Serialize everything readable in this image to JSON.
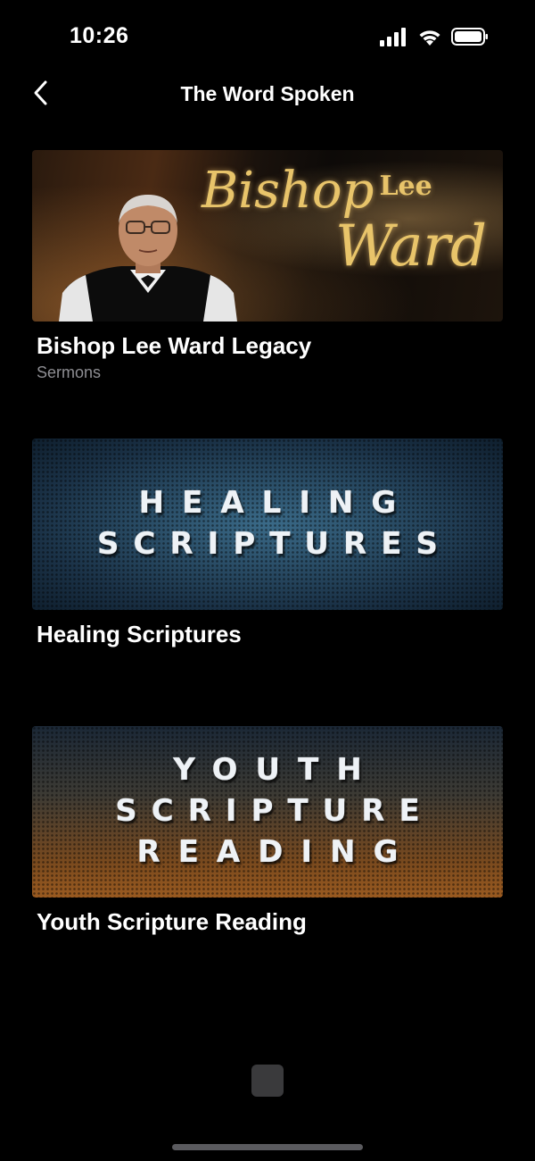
{
  "status_bar": {
    "time": "10:26"
  },
  "nav": {
    "title": "The Word Spoken"
  },
  "items": [
    {
      "title": "Bishop Lee Ward Legacy",
      "subtitle": "Sermons",
      "banner": {
        "script_first": "Bishop",
        "script_middle": "Lee",
        "script_last": "Ward"
      }
    },
    {
      "title": "Healing Scriptures",
      "banner": {
        "lines": [
          "HEALING",
          "SCRIPTURES"
        ]
      }
    },
    {
      "title": "Youth Scripture Reading",
      "banner": {
        "lines": [
          "YOUTH",
          "SCRIPTURE",
          "READING"
        ]
      }
    }
  ],
  "colors": {
    "background": "#000000",
    "subtitle": "#8e8e93",
    "script_gold": "#e8c46a"
  },
  "icons": {
    "back": "chevron-left-icon",
    "signal": "cellular-signal-icon",
    "wifi": "wifi-icon",
    "battery": "battery-icon"
  }
}
